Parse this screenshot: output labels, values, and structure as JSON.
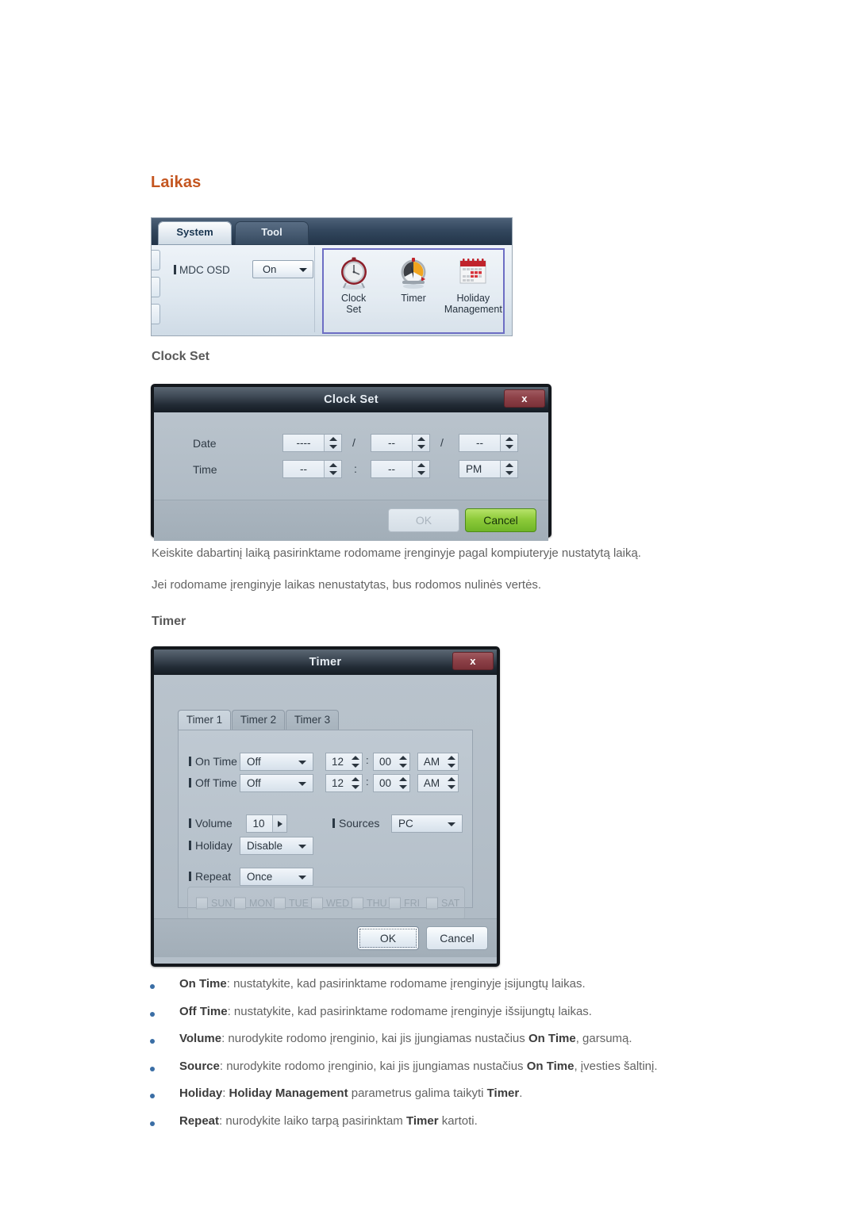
{
  "page": {
    "heading": "Laikas",
    "sub_clock_set": "Clock Set",
    "sub_timer": "Timer",
    "paragraph_1": "Keiskite dabartinį laiką pasirinktame rodomame įrenginyje pagal kompiuteryje nustatytą laiką.",
    "paragraph_2": "Jei rodomame įrenginyje laikas nenustatytas, bus rodomos nulinės vertės.",
    "heading_color": "#c4551f",
    "bullet_color": "#3a6ea5"
  },
  "ribbon": {
    "tabs": [
      {
        "label": "System",
        "active": true
      },
      {
        "label": "Tool",
        "active": false
      }
    ],
    "osd": {
      "label": "MDC OSD",
      "value": "On",
      "caret_icon": "chevron-down-icon"
    },
    "group": {
      "highlight_color": "#6d6ec4",
      "items": [
        {
          "icon": "clock-icon",
          "line1": "Clock",
          "line2": "Set"
        },
        {
          "icon": "timer-gauge-icon",
          "line1": "Timer",
          "line2": ""
        },
        {
          "icon": "calendar-icon",
          "line1": "Holiday",
          "line2": "Management"
        }
      ]
    }
  },
  "clock_set_dialog": {
    "title": "Clock Set",
    "close_label": "x",
    "rows": [
      {
        "label": "Date",
        "fields": [
          {
            "value": "----"
          },
          {
            "value": "--"
          },
          {
            "value": "--"
          }
        ],
        "separators": [
          "/",
          "/"
        ]
      },
      {
        "label": "Time",
        "fields": [
          {
            "value": "--"
          },
          {
            "value": "--"
          },
          {
            "value": "PM"
          }
        ],
        "separators": [
          ":",
          ""
        ]
      }
    ],
    "buttons": {
      "ok": "OK",
      "cancel": "Cancel"
    }
  },
  "timer_dialog": {
    "title": "Timer",
    "close_label": "x",
    "tabs": [
      {
        "label": "Timer 1",
        "active": true
      },
      {
        "label": "Timer 2",
        "active": false
      },
      {
        "label": "Timer 3",
        "active": false
      }
    ],
    "on_time": {
      "label": "On Time",
      "mode": "Off",
      "hour": "12",
      "minute": "00",
      "meridiem": "AM"
    },
    "off_time": {
      "label": "Off Time",
      "mode": "Off",
      "hour": "12",
      "minute": "00",
      "meridiem": "AM"
    },
    "volume": {
      "label": "Volume",
      "value": "10"
    },
    "sources": {
      "label": "Sources",
      "value": "PC"
    },
    "holiday": {
      "label": "Holiday",
      "value": "Disable"
    },
    "repeat": {
      "label": "Repeat",
      "value": "Once"
    },
    "days": [
      {
        "label": "SUN",
        "checked": false
      },
      {
        "label": "MON",
        "checked": false
      },
      {
        "label": "TUE",
        "checked": false
      },
      {
        "label": "WED",
        "checked": false
      },
      {
        "label": "THU",
        "checked": false
      },
      {
        "label": "FRI",
        "checked": false
      },
      {
        "label": "SAT",
        "checked": false
      }
    ],
    "buttons": {
      "ok": "OK",
      "cancel": "Cancel"
    },
    "time_separator": ":"
  },
  "bullets": [
    {
      "term": "On Time",
      "rest": ": nustatykite, kad pasirinktame rodomame įrenginyje įsijungtų laikas."
    },
    {
      "term": "Off Time",
      "rest": ": nustatykite, kad pasirinktame rodomame įrenginyje išsijungtų laikas."
    },
    {
      "term": "Volume",
      "rest": ": nurodykite rodomo įrenginio, kai jis įjungiamas nustačius ",
      "term2": "On Time",
      "rest2": ", garsumą."
    },
    {
      "term": "Source",
      "rest": ": nurodykite rodomo įrenginio, kai jis įjungiamas nustačius ",
      "term2": "On Time",
      "rest2": ", įvesties šaltinį."
    },
    {
      "term": "Holiday",
      "rest": ": ",
      "term2": "Holiday Management",
      "rest2": " parametrus galima taikyti ",
      "term3": "Timer",
      "rest3": "."
    },
    {
      "term": "Repeat",
      "rest": ": nurodykite laiko tarpą pasirinktam ",
      "term2": "Timer",
      "rest2": " kartoti."
    }
  ]
}
